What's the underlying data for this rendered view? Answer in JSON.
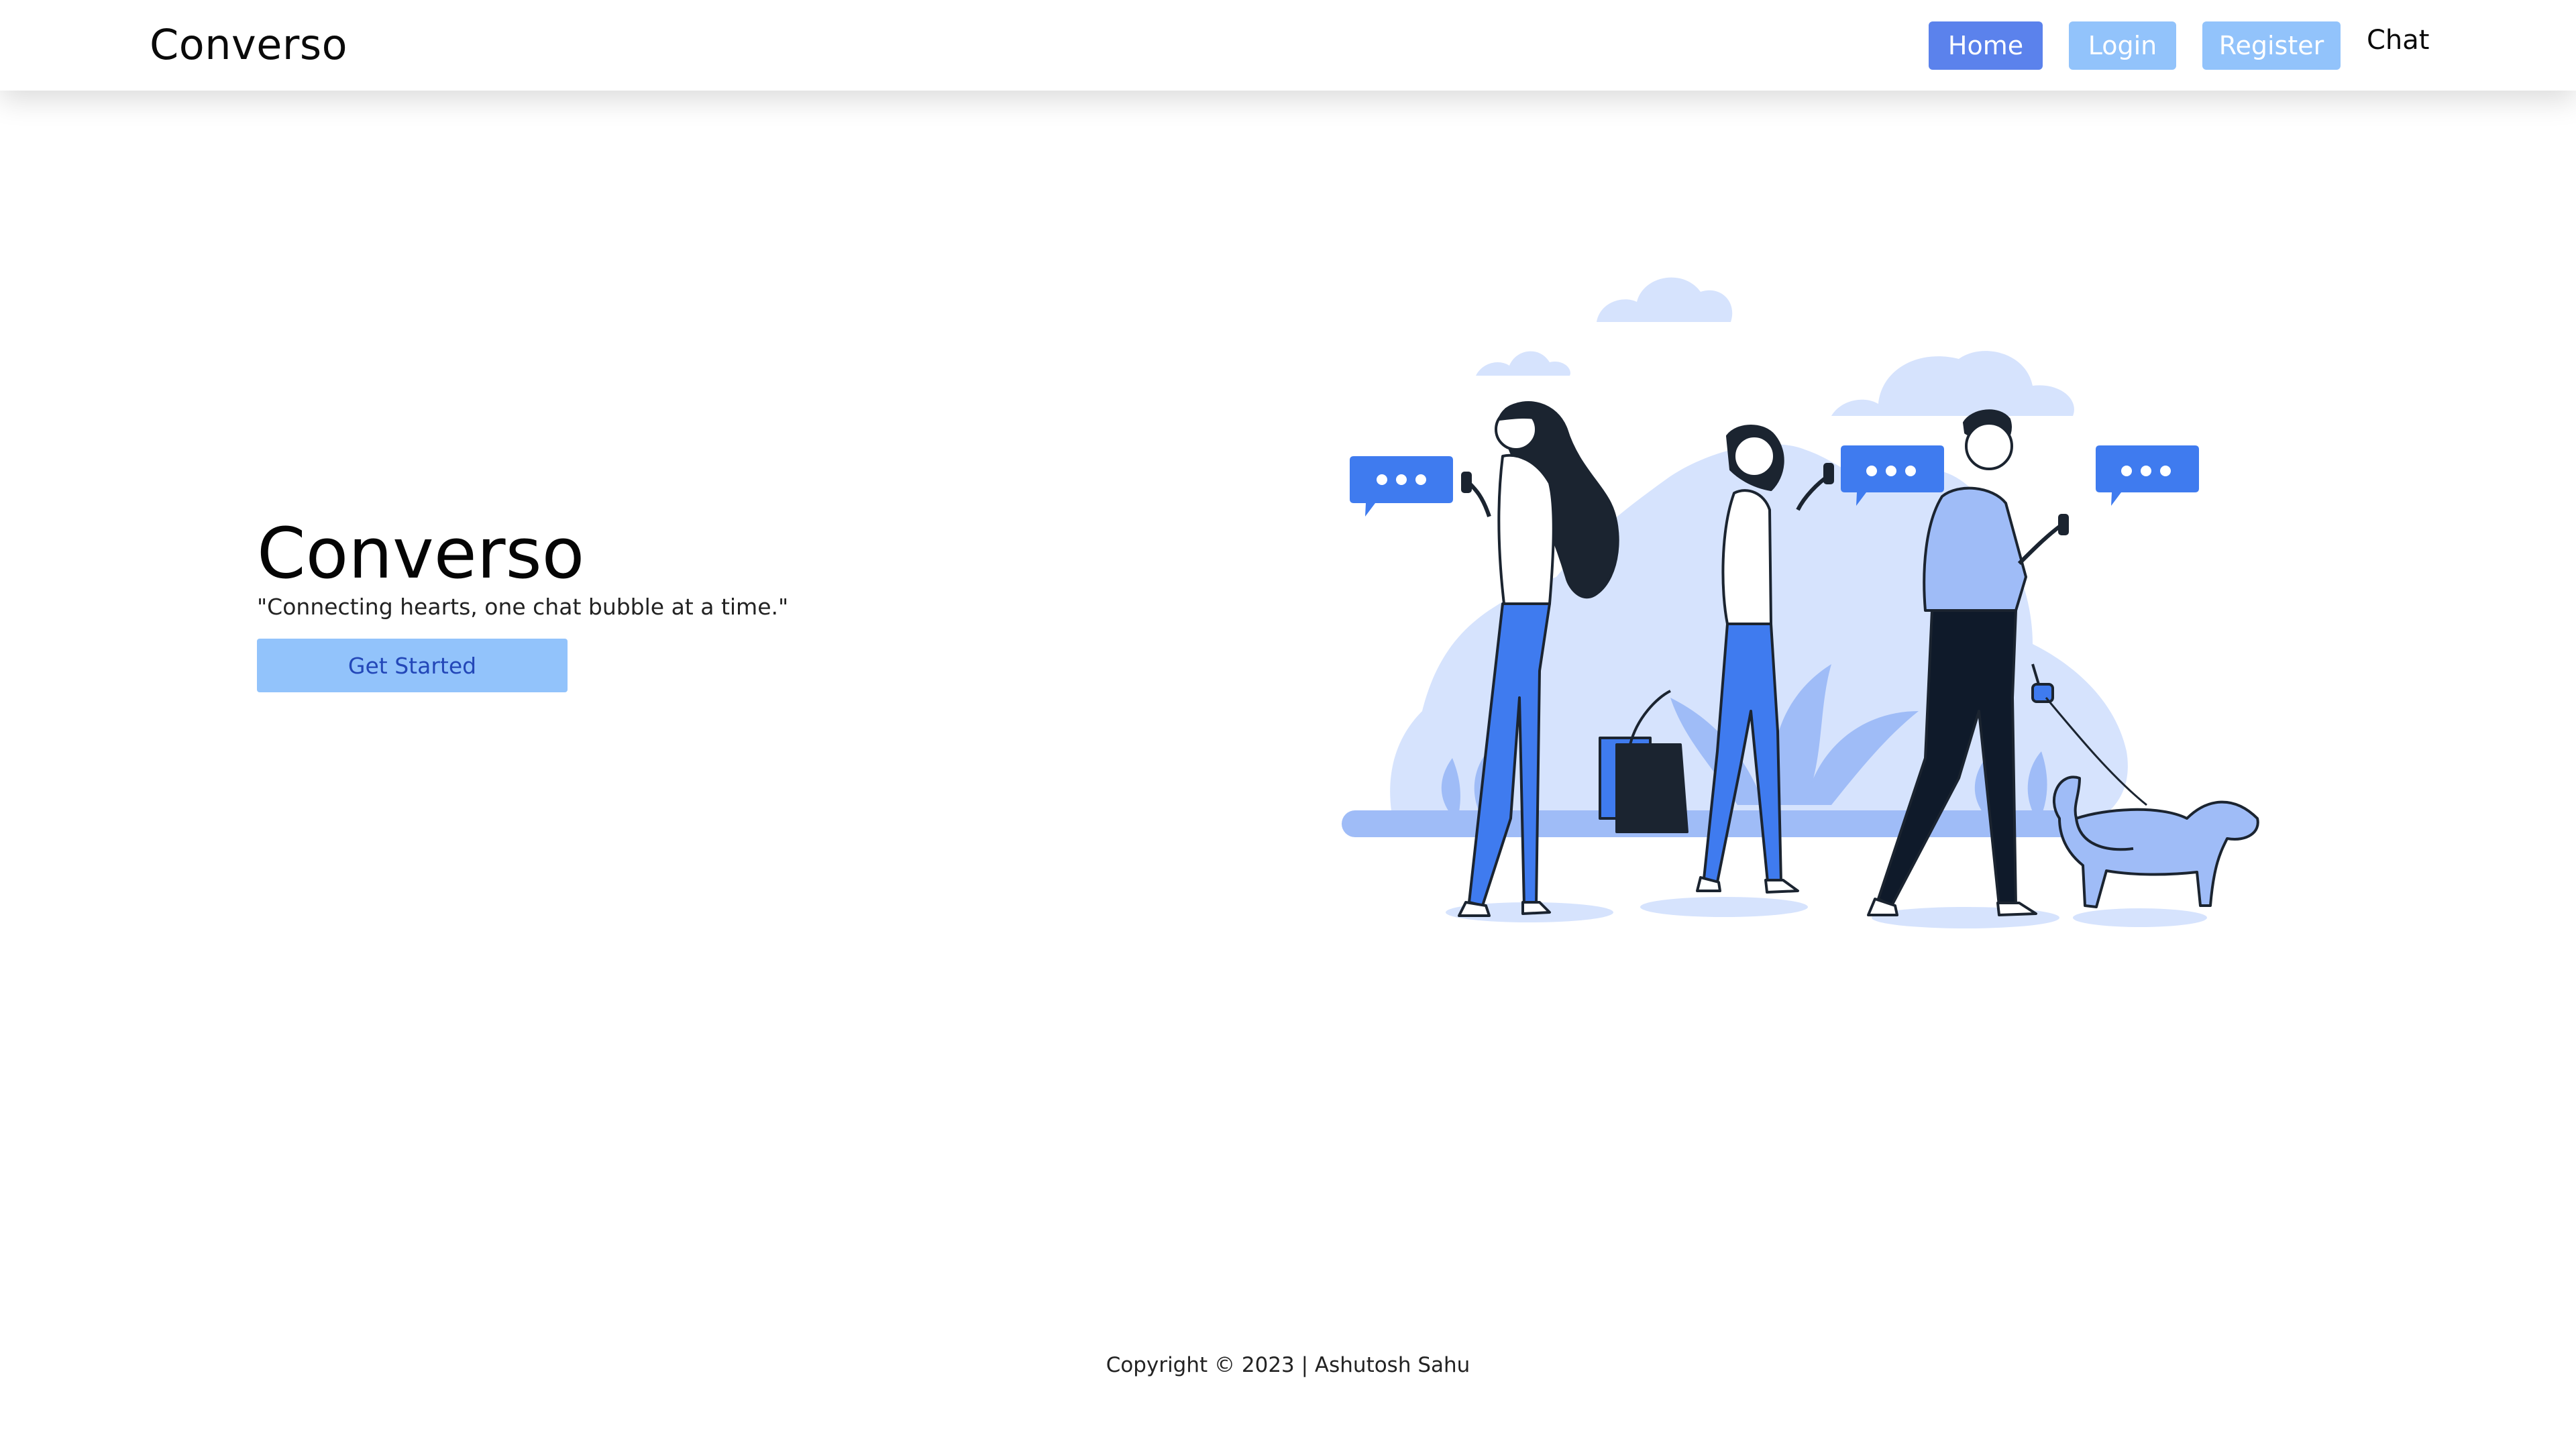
{
  "navbar": {
    "brand": "Converso",
    "links": {
      "home": "Home",
      "login": "Login",
      "register": "Register",
      "chat": "Chat"
    }
  },
  "hero": {
    "title": "Converso",
    "tagline": "\"Connecting hearts, one chat bubble at a time.\"",
    "cta_label": "Get Started"
  },
  "illustration": {
    "subject": "people-walking-with-phones-and-chat-bubbles",
    "colors": {
      "primary": "#3f7bef",
      "light": "#d6e3fd",
      "mid": "#9fbcf7",
      "ink": "#1b2430"
    }
  },
  "footer": {
    "copyright": "Copyright © 2023 | Ashutosh Sahu"
  },
  "colors": {
    "accent": "#5b82ec",
    "button_light": "#92c3fb",
    "cta_text": "#2347b8"
  }
}
